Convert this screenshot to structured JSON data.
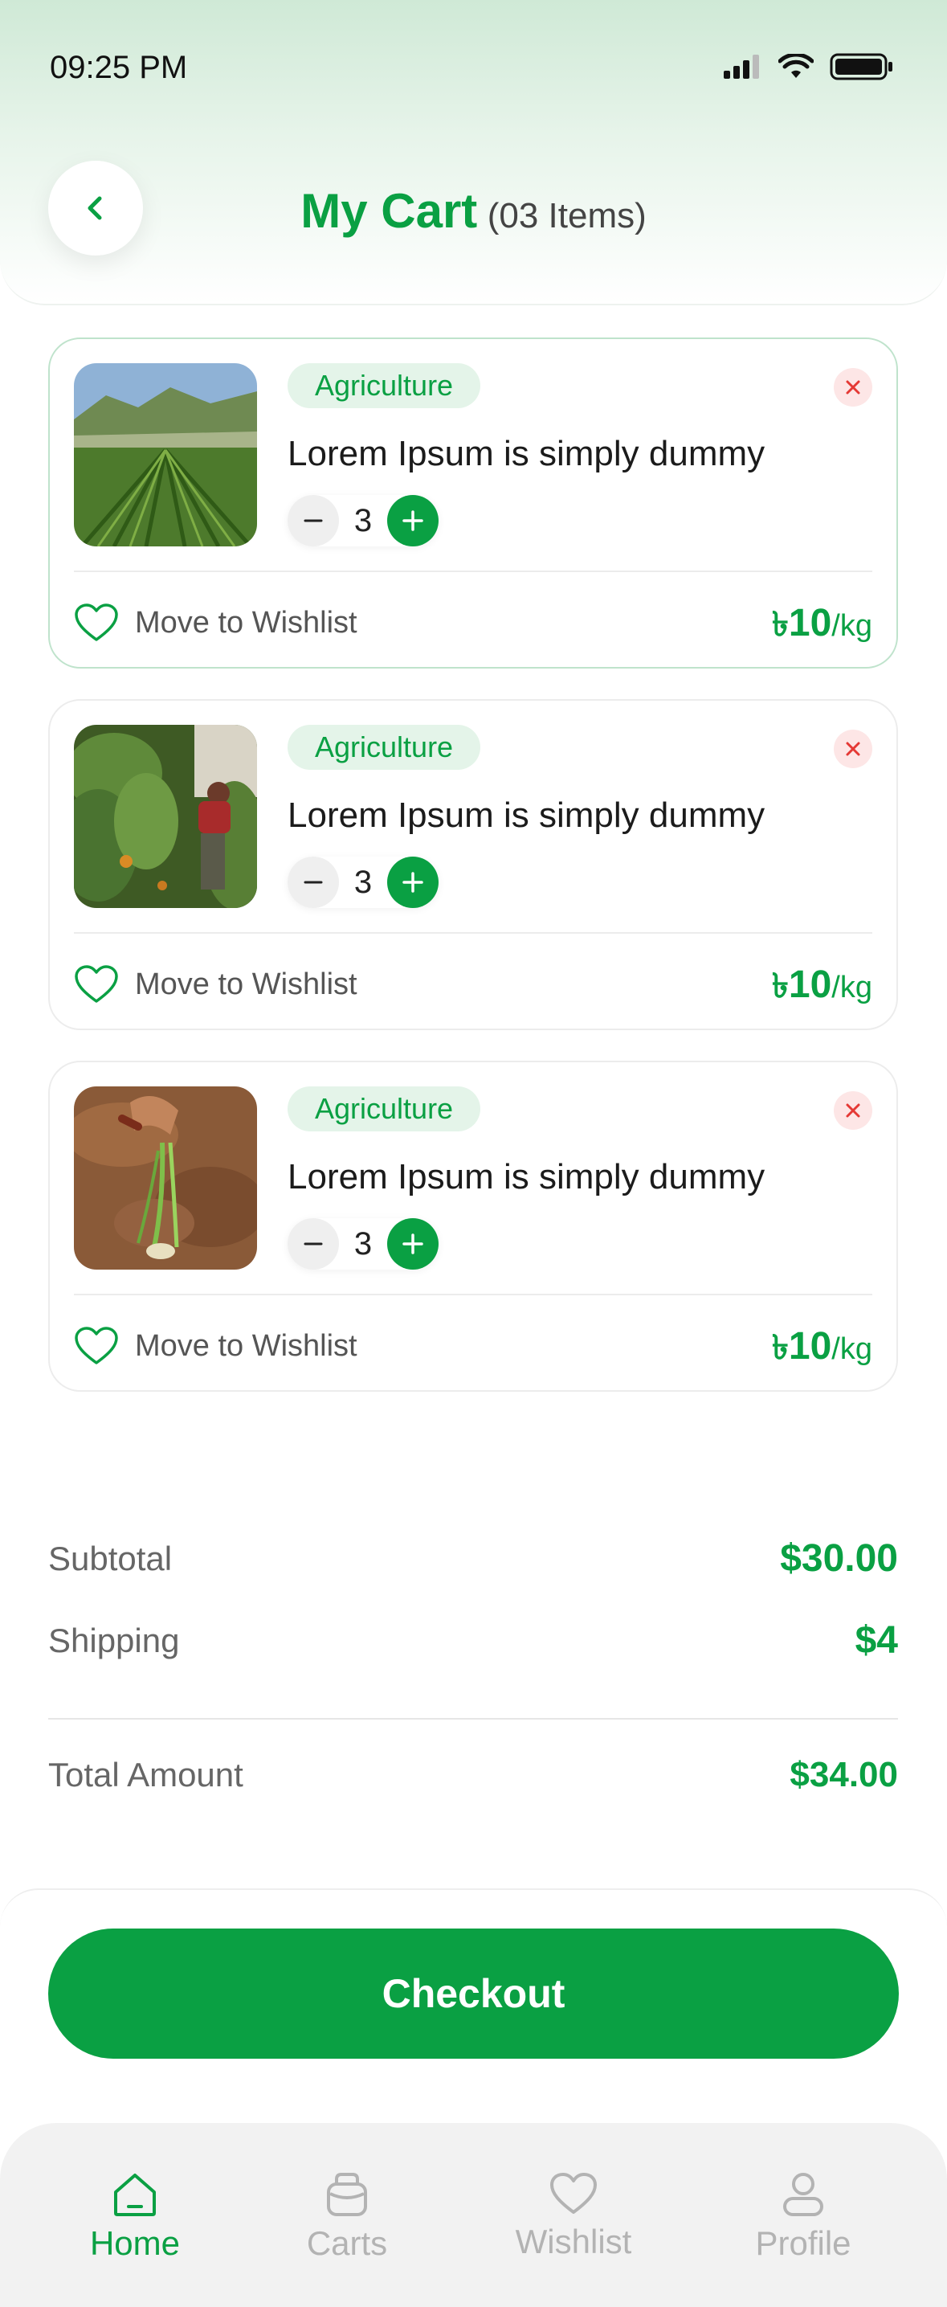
{
  "status_bar": {
    "time": "09:25 PM"
  },
  "header": {
    "title": "My Cart",
    "item_count": "(03 Items)"
  },
  "cart_items": [
    {
      "category": "Agriculture",
      "name": "Lorem Ipsum is simply dummy",
      "quantity": "3",
      "wishlist_label": "Move to Wishlist",
      "currency": "৳",
      "price": "10",
      "unit": "/kg",
      "image": "field-rows-photo"
    },
    {
      "category": "Agriculture",
      "name": "Lorem Ipsum is simply dummy",
      "quantity": "3",
      "wishlist_label": "Move to Wishlist",
      "currency": "৳",
      "price": "10",
      "unit": "/kg",
      "image": "farmer-picking-photo"
    },
    {
      "category": "Agriculture",
      "name": "Lorem Ipsum is simply dummy",
      "quantity": "3",
      "wishlist_label": "Move to Wishlist",
      "currency": "৳",
      "price": "10",
      "unit": "/kg",
      "image": "planting-seedling-photo"
    }
  ],
  "summary": {
    "subtotal_label": "Subtotal",
    "subtotal_value": "$30.00",
    "shipping_label": "Shipping",
    "shipping_value": "$4",
    "total_label": "Total Amount",
    "total_value": "$34.00"
  },
  "checkout": {
    "label": "Checkout"
  },
  "nav": [
    {
      "label": "Home",
      "icon": "home-icon",
      "active": true
    },
    {
      "label": "Carts",
      "icon": "cart-bag-icon",
      "active": false
    },
    {
      "label": "Wishlist",
      "icon": "heart-icon",
      "active": false
    },
    {
      "label": "Profile",
      "icon": "user-icon",
      "active": false
    }
  ],
  "colors": {
    "accent": "#0aa043",
    "badge_bg": "#e4f4e9",
    "remove_bg": "#fde6e6",
    "remove_icon": "#e53935"
  }
}
